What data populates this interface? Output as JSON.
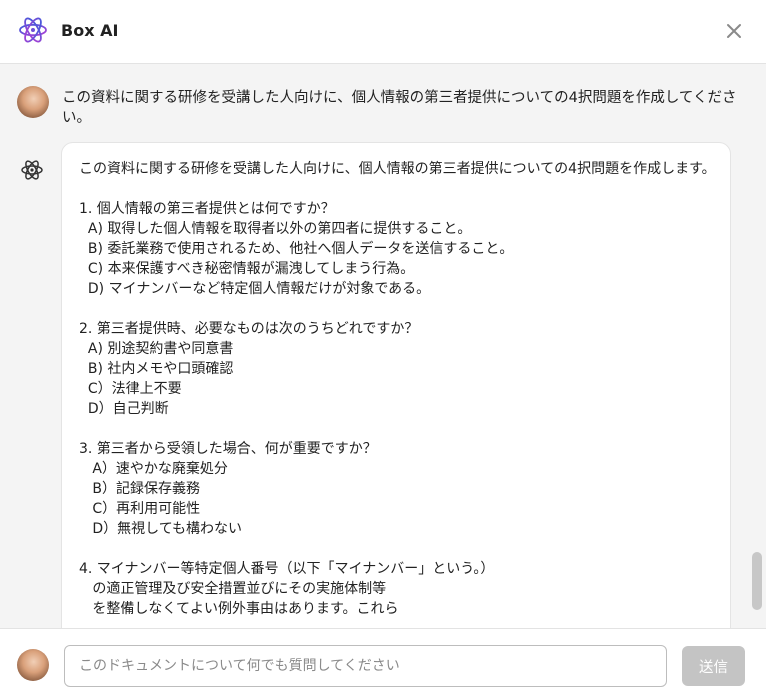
{
  "header": {
    "title": "Box AI",
    "logo_icon": "box-ai-atom-logo",
    "close_icon": "close-x",
    "accent_gradient": [
      "#3b5bdb",
      "#ad3fd4"
    ]
  },
  "conversation": {
    "user_message": "この資料に関する研修を受講した人向けに、個人情報の第三者提供についての4択問題を作成してください。",
    "ai_response": "この資料に関する研修を受講した人向けに、個人情報の第三者提供についての4択問題を作成します。\n\n1. 個人情報の第三者提供とは何ですか？\n  A) 取得した個人情報を取得者以外の第四者に提供すること。\n  B) 委託業務で使用されるため、他社へ個人データを送信すること。\n  C) 本来保護すべき秘密情報が漏洩してしまう行為。\n  D) マイナンバーなど特定個人情報だけが対象である。\n\n2. 第三者提供時、必要なものは次のうちどれですか？\n  A) 別途契約書や同意書\n  B) 社内メモや口頭確認\n  C）法律上不要\n  D）自己判断\n\n3. 第三者から受領した場合、何が重要ですか？\n   A）速やかな廃棄処分\n   B）記録保存義務\n   C）再利用可能性\n   D）無視しても構わない\n\n4. マイナンバー等特定個人番号（以下「マイナンバー」という。）\n   の適正管理及び安全措置並びにその実施体制等\n   を整備しなくてよい例外事由はあります。これら"
  },
  "composer": {
    "placeholder": "このドキュメントについて何でも質問してください",
    "value": "",
    "send_label": "送信",
    "send_color": "#c4c4c4"
  }
}
